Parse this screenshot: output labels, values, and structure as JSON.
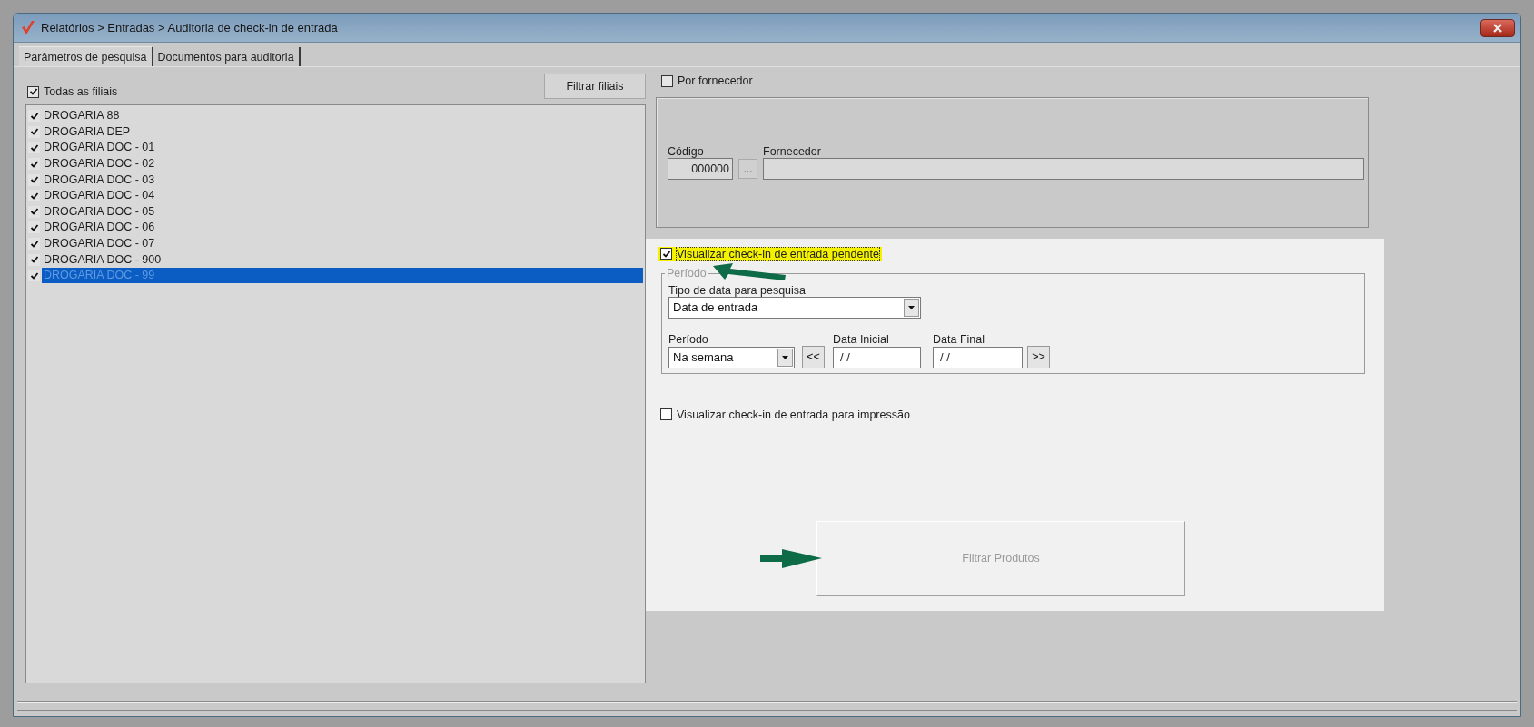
{
  "window": {
    "title": "Relatórios > Entradas > Auditoria de check-in de entrada"
  },
  "tabs": [
    {
      "label": "Parâmetros de pesquisa",
      "selected": true
    },
    {
      "label": "Documentos para auditoria",
      "selected": false
    }
  ],
  "branches": {
    "all": {
      "label": "Todas as filiais",
      "checked": true
    },
    "filter_button": "Filtrar filiais",
    "items": [
      {
        "label": "DROGARIA 88",
        "checked": true,
        "selected": false
      },
      {
        "label": "DROGARIA DEP",
        "checked": true,
        "selected": false
      },
      {
        "label": "DROGARIA DOC - 01",
        "checked": true,
        "selected": false
      },
      {
        "label": "DROGARIA DOC - 02",
        "checked": true,
        "selected": false
      },
      {
        "label": "DROGARIA DOC - 03",
        "checked": true,
        "selected": false
      },
      {
        "label": "DROGARIA DOC - 04",
        "checked": true,
        "selected": false
      },
      {
        "label": "DROGARIA DOC - 05",
        "checked": true,
        "selected": false
      },
      {
        "label": "DROGARIA DOC - 06",
        "checked": true,
        "selected": false
      },
      {
        "label": "DROGARIA DOC - 07",
        "checked": true,
        "selected": false
      },
      {
        "label": "DROGARIA DOC - 900",
        "checked": true,
        "selected": false
      },
      {
        "label": "DROGARIA DOC - 99",
        "checked": true,
        "selected": true
      }
    ]
  },
  "supplier": {
    "label": "Por fornecedor",
    "checked": false,
    "code_label": "Código",
    "code_value": "000000",
    "browse_button": "...",
    "name_label": "Fornecedor"
  },
  "pending_option": {
    "label": "Visualizar check-in de entrada pendente",
    "checked": true,
    "highlighted": true
  },
  "period_group": {
    "title": "Período",
    "date_type_label": "Tipo de data para pesquisa",
    "date_type_value": "Data de entrada",
    "period_label": "Período",
    "period_value": "Na semana",
    "prev_button": "<<",
    "start_label": "Data Inicial",
    "start_value": "/ /",
    "end_label": "Data Final",
    "end_value": "/ /",
    "next_button": ">>"
  },
  "print_option": {
    "label": "Visualizar check-in de entrada para impressão",
    "checked": false
  },
  "filter_products_button": {
    "label": "Filtrar Produtos",
    "disabled": true
  }
}
